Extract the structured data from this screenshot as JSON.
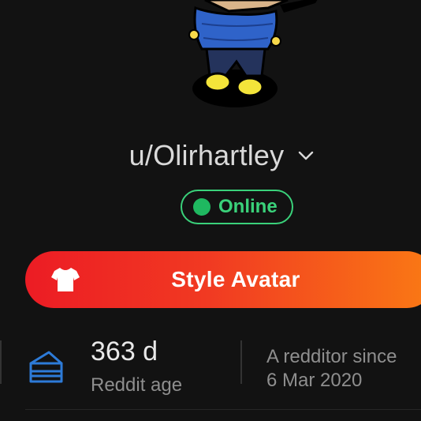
{
  "profile": {
    "username": "u/Olirhartley",
    "status_label": "Online"
  },
  "style_button": {
    "label": "Style Avatar"
  },
  "stats": {
    "age_value": "363 d",
    "age_label": "Reddit age",
    "since_label": "A redditor since",
    "since_value": "6 Mar 2020"
  },
  "icons": {
    "username_menu": "chevron-down-icon",
    "style_button": "shirt-icon",
    "reddit_age": "cake-icon"
  },
  "colors": {
    "background": "#121212",
    "online_green": "#3ad17a",
    "button_gradient_start": "#ec1c24",
    "button_gradient_end": "#fa7a14",
    "stat_icon_blue": "#2d7bd8"
  }
}
